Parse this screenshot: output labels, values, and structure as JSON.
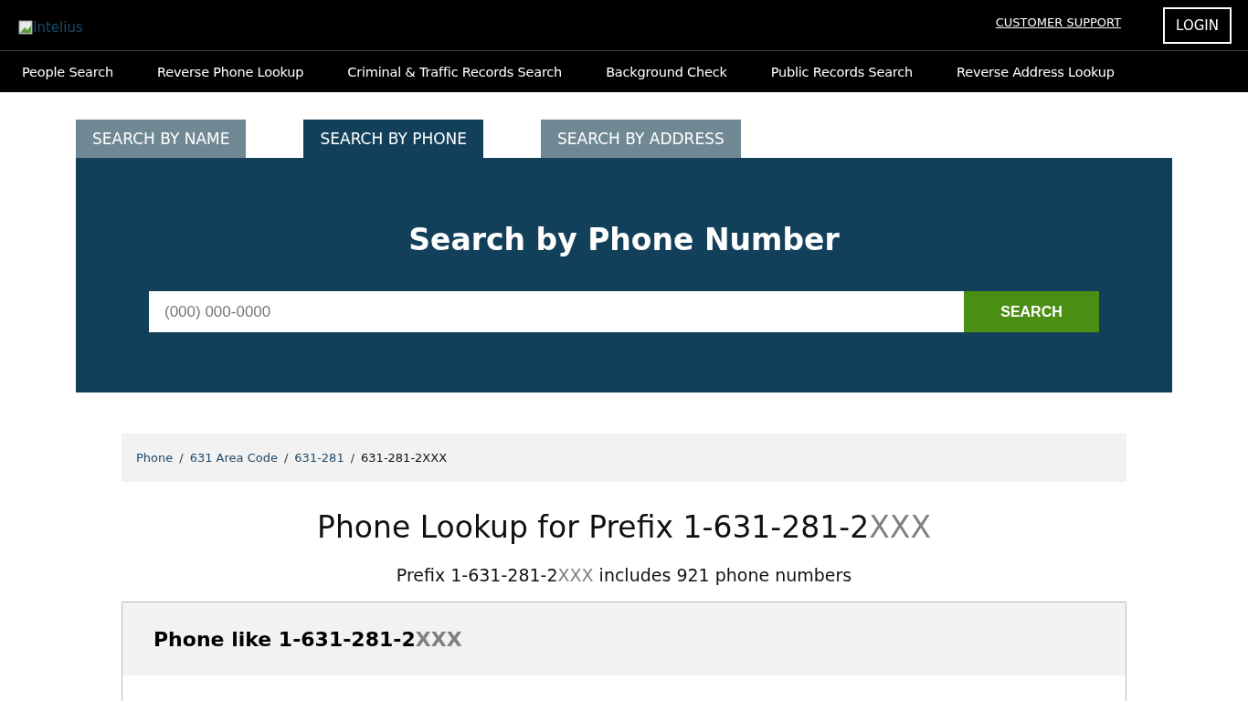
{
  "header": {
    "logo_alt": "Intelius",
    "support_link": "CUSTOMER SUPPORT",
    "login_button": "LOGIN"
  },
  "nav": [
    "People Search",
    "Reverse Phone Lookup",
    "Criminal & Traffic Records Search",
    "Background Check",
    "Public Records Search",
    "Reverse Address Lookup"
  ],
  "tabs": [
    {
      "label": "SEARCH BY NAME",
      "selected": false
    },
    {
      "label": "SEARCH BY PHONE",
      "selected": true
    },
    {
      "label": "SEARCH BY ADDRESS",
      "selected": false
    }
  ],
  "search": {
    "title": "Search by Phone Number",
    "placeholder": "(000) 000-0000",
    "button": "SEARCH"
  },
  "breadcrumb_separator": "/",
  "breadcrumbs": [
    {
      "label": "Phone",
      "link": true
    },
    {
      "label": "631 Area Code",
      "link": true
    },
    {
      "label": "631-281",
      "link": true
    },
    {
      "label": "631-281-2XXX",
      "link": false
    }
  ],
  "heading": {
    "text": "Phone Lookup for Prefix 1-631-281-2",
    "masked": "XXX"
  },
  "summary": {
    "before": "Prefix 1-631-281-2",
    "masked": "XXX",
    "after": " includes 921 phone numbers"
  },
  "panel": {
    "title": "Phone like 1-631-281-2",
    "masked": "XXX"
  }
}
